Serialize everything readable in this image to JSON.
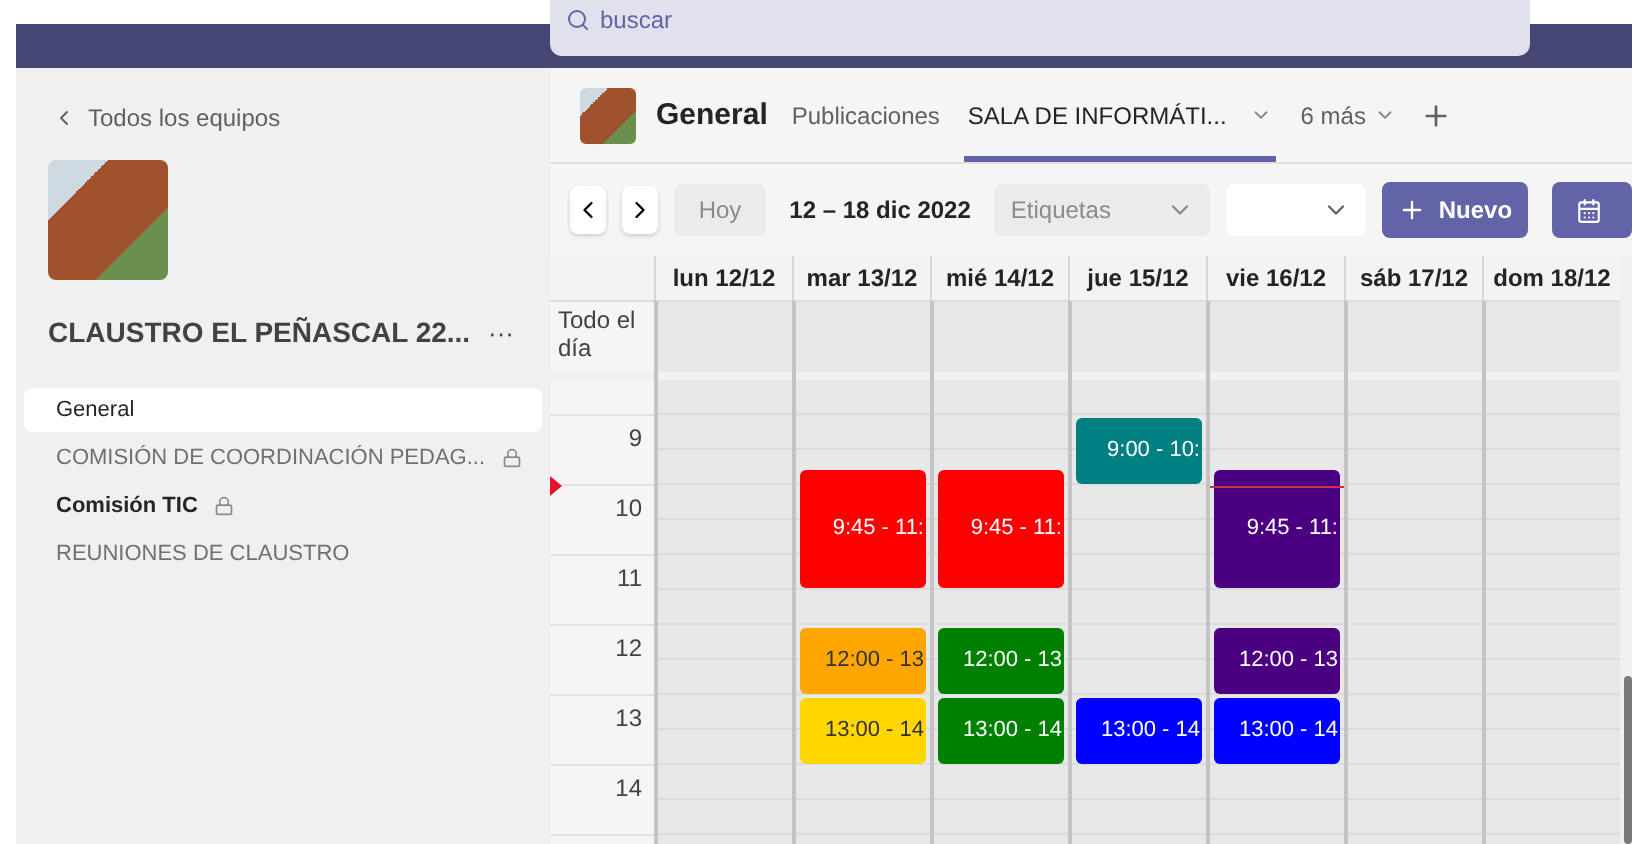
{
  "search": {
    "placeholder": "buscar"
  },
  "sidebar": {
    "back_link": "Todos los equipos",
    "team_name": "CLAUSTRO EL PEÑASCAL 22...",
    "more": "···",
    "channels": [
      {
        "label": "General",
        "selected": true,
        "bold": false,
        "locked": false
      },
      {
        "label": "COMISIÓN DE COORDINACIÓN PEDAG...",
        "selected": false,
        "bold": false,
        "locked": true
      },
      {
        "label": "Comisión TIC",
        "selected": false,
        "bold": true,
        "locked": true
      },
      {
        "label": "REUNIONES DE CLAUSTRO",
        "selected": false,
        "bold": false,
        "locked": false
      }
    ]
  },
  "channel_header": {
    "title": "General",
    "tabs": [
      {
        "label": "Publicaciones",
        "selected": false,
        "has_menu": false
      },
      {
        "label": "SALA DE INFORMÁTI...",
        "selected": true,
        "has_menu": true
      }
    ],
    "more_tabs": "6 más"
  },
  "toolbar": {
    "today": "Hoy",
    "range": "12 – 18 dic 2022",
    "tags_placeholder": "Etiquetas",
    "new": "Nuevo"
  },
  "calendar": {
    "all_day": "Todo el día",
    "hours": [
      "9",
      "10",
      "11",
      "12",
      "13",
      "14"
    ],
    "days": [
      {
        "label": "lun 12/12",
        "current_time": false
      },
      {
        "label": "mar 13/12",
        "current_time": false,
        "events": [
          {
            "label": "9:45 - 11:",
            "kind": "long",
            "color": "#ff0000"
          },
          {
            "label": "12:00 - 13",
            "kind": "hour",
            "color": "#ffa500"
          },
          {
            "label": "13:00 - 14",
            "kind": "hour",
            "color": "#ffd700"
          }
        ]
      },
      {
        "label": "mié 14/12",
        "current_time": false,
        "events": [
          {
            "label": "9:45 - 11:",
            "kind": "long",
            "color": "#ff0000"
          },
          {
            "label": "12:00 - 13",
            "kind": "hour",
            "color": "#008000"
          },
          {
            "label": "13:00 - 14",
            "kind": "hour",
            "color": "#008000"
          }
        ]
      },
      {
        "label": "jue 15/12",
        "current_time": false,
        "events": [
          {
            "label": "9:00 - 10:",
            "kind": "hour",
            "color": "#008080"
          },
          {
            "label": "13:00 - 14",
            "kind": "hour",
            "color": "#0000ff"
          }
        ]
      },
      {
        "label": "vie 16/12",
        "current_time": true,
        "events": [
          {
            "label": "9:45 - 11:",
            "kind": "long",
            "color": "#4b0082"
          },
          {
            "label": "12:00 - 13",
            "kind": "hour",
            "color": "#4b0082"
          },
          {
            "label": "13:00 - 14",
            "kind": "hour",
            "color": "#0000ff"
          }
        ]
      },
      {
        "label": "sáb 17/12",
        "current_time": false
      },
      {
        "label": "dom 18/12",
        "current_time": false
      }
    ]
  }
}
